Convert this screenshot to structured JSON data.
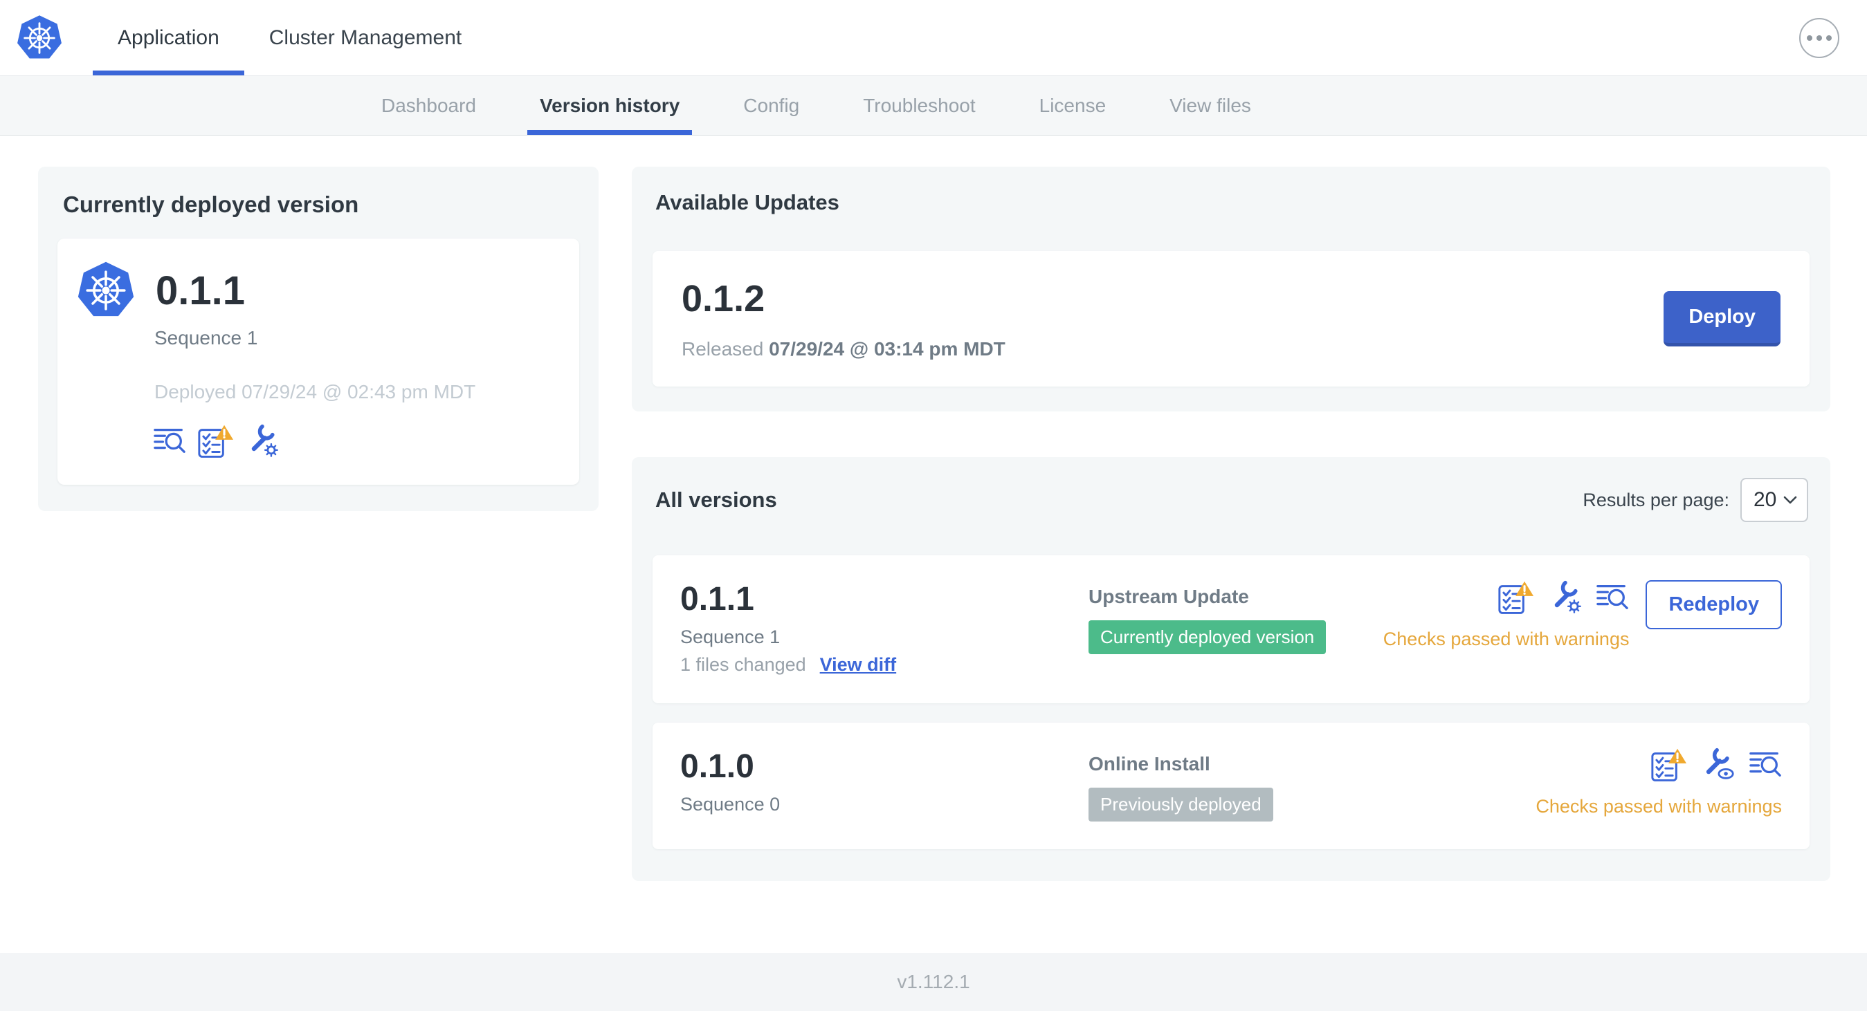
{
  "header": {
    "app_tabs": [
      {
        "label": "Application",
        "active": true
      },
      {
        "label": "Cluster Management",
        "active": false
      }
    ]
  },
  "subnav": {
    "tabs": [
      {
        "label": "Dashboard",
        "active": false
      },
      {
        "label": "Version history",
        "active": true
      },
      {
        "label": "Config",
        "active": false
      },
      {
        "label": "Troubleshoot",
        "active": false
      },
      {
        "label": "License",
        "active": false
      },
      {
        "label": "View files",
        "active": false
      }
    ]
  },
  "currently_deployed": {
    "title": "Currently deployed version",
    "version": "0.1.1",
    "sequence": "Sequence 1",
    "deployed_at": "Deployed 07/29/24 @ 02:43 pm MDT"
  },
  "available_updates": {
    "title": "Available Updates",
    "version": "0.1.2",
    "released_prefix": "Released",
    "released_at": "07/29/24 @ 03:14 pm MDT",
    "deploy_label": "Deploy"
  },
  "all_versions": {
    "title": "All versions",
    "results_per_page_label": "Results per page:",
    "results_per_page_value": "20",
    "rows": [
      {
        "version": "0.1.1",
        "sequence": "Sequence 1",
        "files_changed": "1 files changed",
        "view_diff_label": "View diff",
        "source": "Upstream Update",
        "status_badge": "Currently deployed version",
        "badge_color": "#4cbb8a",
        "checks_text": "Checks passed with warnings",
        "action_label": "Redeploy"
      },
      {
        "version": "0.1.0",
        "sequence": "Sequence 0",
        "source": "Online Install",
        "status_badge": "Previously deployed",
        "badge_color": "#b2bcc0",
        "checks_text": "Checks passed with warnings"
      }
    ]
  },
  "footer": {
    "app_version": "v1.112.1"
  },
  "colors": {
    "accent_blue": "#3b66d8",
    "deploy_button_blue": "#3d62c9",
    "kubernetes_blue": "#3a6de0",
    "badge_green": "#4cbb8a",
    "badge_gray": "#b2bcc0",
    "warning_orange": "#e5a73c",
    "warning_triangle": "#f0a92e"
  }
}
